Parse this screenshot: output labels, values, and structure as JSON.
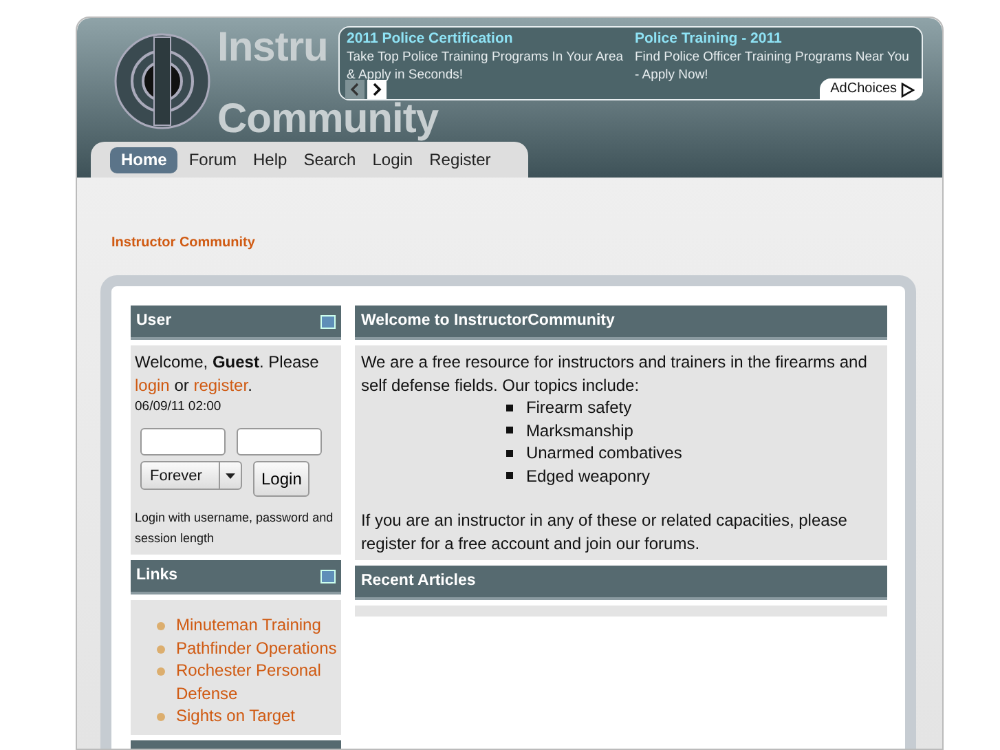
{
  "logo": {
    "lines": [
      "Instru",
      "Community"
    ]
  },
  "ad": {
    "items": [
      {
        "title": "2011 Police Certification",
        "text": "Take Top Police Training Programs In Your Area & Apply in Seconds!"
      },
      {
        "title": "Police Training - 2011",
        "text": "Find Police Officer Training Programs Near You - Apply Now!"
      }
    ],
    "prev_disabled": true,
    "adchoices": "AdChoices"
  },
  "nav": [
    {
      "label": "Home",
      "selected": true
    },
    {
      "label": "Forum",
      "selected": false
    },
    {
      "label": "Help",
      "selected": false
    },
    {
      "label": "Search",
      "selected": false
    },
    {
      "label": "Login",
      "selected": false
    },
    {
      "label": "Register",
      "selected": false
    }
  ],
  "breadcrumb": "Instructor Community",
  "user_block": {
    "title": "User",
    "welcome": "Welcome, **Guest**. Please",
    "login_link": "login",
    "or": "or",
    "register_link": "register",
    "end": ".",
    "date": "06/09/11 02:00",
    "remember": "Forever",
    "login_button": "Login",
    "hint": "Login with username, password and session length"
  },
  "links_block": {
    "title": "Links",
    "items": [
      "Minuteman Training",
      "Pathfinder Operations",
      "Rochester Personal Defense",
      "Sights on Target"
    ]
  },
  "main": [
    {
      "title": "Welcome to InstructorCommunity",
      "intro": "We are a free resource for instructors and trainers in the firearms and self defense fields.  Our topics include:",
      "topics": [
        "Firearm safety",
        "Marksmanship",
        "Unarmed combatives",
        "Edged weaponry"
      ],
      "outro": "If you are an instructor in any of these or related capacities, please register for a free account and join our forums."
    },
    {
      "title": "Recent Articles"
    }
  ]
}
